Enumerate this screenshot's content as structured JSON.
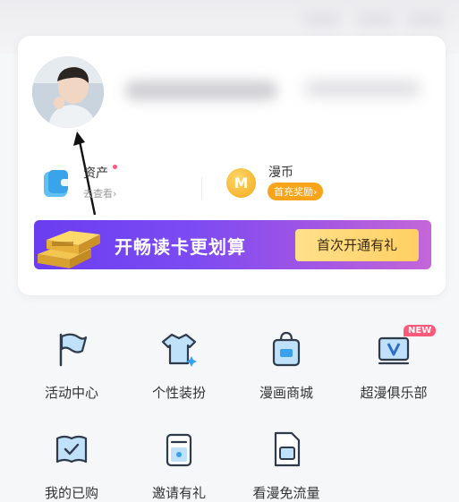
{
  "profile": {
    "wallet_title": "资产",
    "wallet_sub": "去查看",
    "wallet_sub_chevron": "›",
    "coin_title": "漫币",
    "coin_badge": "首充奖励",
    "coin_badge_chevron": "›",
    "coin_letter": "M"
  },
  "banner": {
    "text": "开畅读卡更划算",
    "button": "首次开通有礼"
  },
  "grid": [
    {
      "label": "活动中心",
      "icon": "flag-icon"
    },
    {
      "label": "个性装扮",
      "icon": "tshirt-icon"
    },
    {
      "label": "漫画商城",
      "icon": "shopping-bag-icon"
    },
    {
      "label": "超漫俱乐部",
      "icon": "vip-card-icon"
    },
    {
      "label": "我的已购",
      "icon": "purchased-icon"
    },
    {
      "label": "邀请有礼",
      "icon": "invite-gift-icon"
    },
    {
      "label": "看漫免流量",
      "icon": "sim-card-icon"
    }
  ],
  "new_badge": "NEW",
  "colors": {
    "accent": "#4a9be8",
    "coin": "#f7a41a",
    "banner_start": "#6a3df0",
    "banner_btn": "#ffd063",
    "badge": "#ff5a7a"
  }
}
